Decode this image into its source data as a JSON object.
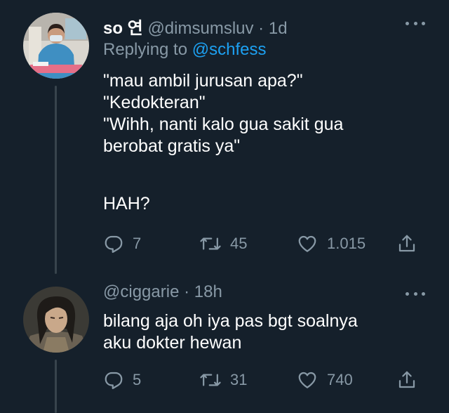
{
  "tweets": [
    {
      "display_name": "so 연",
      "handle": "@dimsumsluv",
      "separator": "·",
      "time": "1d",
      "reply_prefix": "Replying to",
      "reply_to": "@schfess",
      "lines": [
        "\"mau ambil jurusan apa?\"",
        "\"Kedokteran\"",
        "\"Wihh, nanti kalo gua sakit gua",
        "berobat gratis ya\"",
        "",
        "HAH?"
      ],
      "replies": "7",
      "retweets": "45",
      "likes": "1.015"
    },
    {
      "handle": "@ciggarie",
      "separator": "·",
      "time": "18h",
      "lines": [
        "bilang aja oh iya pas bgt soalnya",
        "aku dokter hewan"
      ],
      "replies": "5",
      "retweets": "31",
      "likes": "740"
    }
  ],
  "colors": {
    "background": "#15202b",
    "text": "#ffffff",
    "secondary": "#8899a6",
    "link": "#1da1f2",
    "thread_line": "#38444d"
  },
  "icons": [
    "more-icon",
    "reply-icon",
    "retweet-icon",
    "like-icon",
    "share-icon"
  ]
}
